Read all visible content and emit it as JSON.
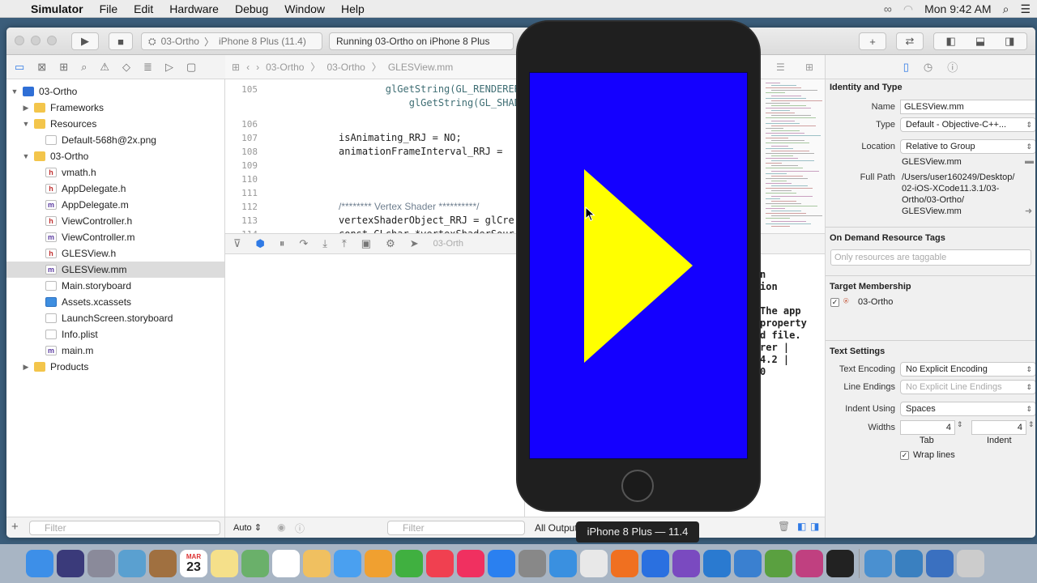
{
  "menubar": {
    "apple": "",
    "app": "Simulator",
    "items": [
      "File",
      "Edit",
      "Hardware",
      "Debug",
      "Window",
      "Help"
    ],
    "clock": "Mon 9:42 AM"
  },
  "toolbar": {
    "scheme": "03-Ortho",
    "device": "iPhone 8 Plus (11.4)",
    "status": "Running 03-Ortho on iPhone 8 Plus"
  },
  "jumpbar": {
    "crumbs": [
      "03-Ortho",
      "03-Ortho",
      "GLESView.mm"
    ]
  },
  "navigator": {
    "rows": [
      {
        "label": "03-Ortho",
        "kind": "proj",
        "depth": 0,
        "disc": "▼"
      },
      {
        "label": "Frameworks",
        "kind": "folder",
        "depth": 1,
        "disc": "▶"
      },
      {
        "label": "Resources",
        "kind": "folder",
        "depth": 1,
        "disc": "▼"
      },
      {
        "label": "Default-568h@2x.png",
        "kind": "pfile",
        "depth": 2,
        "disc": ""
      },
      {
        "label": "03-Ortho",
        "kind": "folder",
        "depth": 1,
        "disc": "▼"
      },
      {
        "label": "vmath.h",
        "kind": "hfile",
        "depth": 2,
        "disc": ""
      },
      {
        "label": "AppDelegate.h",
        "kind": "hfile",
        "depth": 2,
        "disc": ""
      },
      {
        "label": "AppDelegate.m",
        "kind": "mfile",
        "depth": 2,
        "disc": ""
      },
      {
        "label": "ViewController.h",
        "kind": "hfile",
        "depth": 2,
        "disc": ""
      },
      {
        "label": "ViewController.m",
        "kind": "mfile",
        "depth": 2,
        "disc": ""
      },
      {
        "label": "GLESView.h",
        "kind": "hfile",
        "depth": 2,
        "disc": ""
      },
      {
        "label": "GLESView.mm",
        "kind": "mfile",
        "depth": 2,
        "disc": "",
        "selected": true
      },
      {
        "label": "Main.storyboard",
        "kind": "pfile",
        "depth": 2,
        "disc": ""
      },
      {
        "label": "Assets.xcassets",
        "kind": "afile",
        "depth": 2,
        "disc": ""
      },
      {
        "label": "LaunchScreen.storyboard",
        "kind": "pfile",
        "depth": 2,
        "disc": ""
      },
      {
        "label": "Info.plist",
        "kind": "pfile",
        "depth": 2,
        "disc": ""
      },
      {
        "label": "main.m",
        "kind": "mfile",
        "depth": 2,
        "disc": ""
      },
      {
        "label": "Products",
        "kind": "folder",
        "depth": 1,
        "disc": "▶"
      }
    ],
    "filter_placeholder": "Filter"
  },
  "code": {
    "lines": [
      {
        "n": "105",
        "text": "        glGetString(GL_RENDERER),"
      },
      {
        "n": "",
        "text": "            glGetString(GL_SHADING"
      },
      {
        "n": "106",
        "text": ""
      },
      {
        "n": "107",
        "text": "isAnimating_RRJ = NO;"
      },
      {
        "n": "108",
        "text": "animationFrameInterval_RRJ ="
      },
      {
        "n": "109",
        "text": ""
      },
      {
        "n": "110",
        "text": ""
      },
      {
        "n": "111",
        "text": ""
      },
      {
        "n": "112",
        "text": "/******** Vertex Shader **********/"
      },
      {
        "n": "113",
        "text": "vertexShaderObject_RRJ = glCre"
      },
      {
        "n": "114",
        "text": "const GLchar *vertexShaderSour"
      }
    ]
  },
  "debug": {
    "console_lines": [
      "n",
      "ion",
      "",
      "The app",
      "property",
      "d file.",
      "rer |",
      "4.2 |",
      "0"
    ],
    "auto_label": "Auto",
    "filter_placeholder": "Filter",
    "output_label": "All Output",
    "process": "03-Orth"
  },
  "inspector": {
    "section_identity": "Identity and Type",
    "name_label": "Name",
    "name_value": "GLESView.mm",
    "type_label": "Type",
    "type_value": "Default - Objective-C++...",
    "location_label": "Location",
    "location_value": "Relative to Group",
    "location_file": "GLESView.mm",
    "fullpath_label": "Full Path",
    "fullpath_lines": [
      "/Users/user160249/Desktop/",
      "02-iOS-XCode11.3.1/03-",
      "Ortho/03-Ortho/",
      "GLESView.mm"
    ],
    "section_ondemand": "On Demand Resource Tags",
    "tags_placeholder": "Only resources are taggable",
    "section_target": "Target Membership",
    "target_name": "03-Ortho",
    "section_text": "Text Settings",
    "encoding_label": "Text Encoding",
    "encoding_value": "No Explicit Encoding",
    "lineend_label": "Line Endings",
    "lineend_value": "No Explicit Line Endings",
    "indent_label": "Indent Using",
    "indent_value": "Spaces",
    "widths_label": "Widths",
    "tab_value": "4",
    "indent_width_value": "4",
    "tab_caption": "Tab",
    "indent_caption": "Indent",
    "wrap_label": "Wrap lines"
  },
  "simulator": {
    "tooltip": "iPhone 8 Plus — 11.4",
    "screen_color": "#1400ff",
    "triangle_color": "#ffff00"
  },
  "dock": {
    "apps": [
      "finder",
      "siri",
      "launchpad",
      "preview",
      "notebook",
      "calendar",
      "notes",
      "maps",
      "reminders",
      "photos",
      "messages",
      "pages",
      "numbers",
      "news",
      "music",
      "app-store",
      "system-preferences",
      "safari",
      "chrome",
      "firefox",
      "dropbox",
      "visual-studio",
      "vscode",
      "xcode",
      "android",
      "flower",
      "terminal",
      "folder-xcode",
      "folder-instruments",
      "folder-simulator",
      "trash"
    ],
    "calendar_month": "MAR",
    "calendar_day": "23"
  }
}
